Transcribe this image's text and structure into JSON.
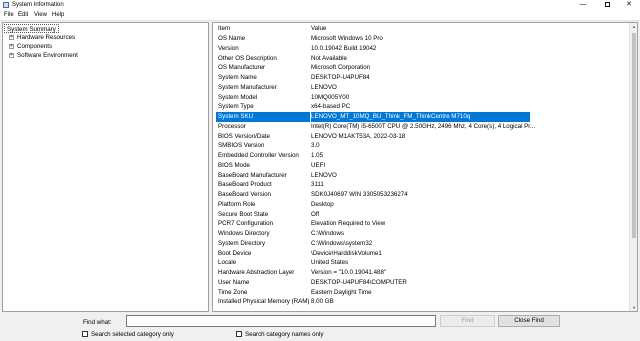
{
  "window": {
    "title": "System Information",
    "minimize_glyph": "—",
    "close_glyph": "✕"
  },
  "menu": [
    "File",
    "Edit",
    "View",
    "Help"
  ],
  "tree": {
    "root": "System Summary",
    "children": [
      "Hardware Resources",
      "Components",
      "Software Environment"
    ],
    "expander_glyph": "+"
  },
  "details": {
    "headers": {
      "item": "Item",
      "value": "Value"
    },
    "selected_index": 8,
    "rows": [
      {
        "item": "OS Name",
        "value": "Microsoft Windows 10 Pro"
      },
      {
        "item": "Version",
        "value": "10.0.19042 Build 19042"
      },
      {
        "item": "Other OS Description",
        "value": "Not Available"
      },
      {
        "item": "OS Manufacturer",
        "value": "Microsoft Corporation"
      },
      {
        "item": "System Name",
        "value": "DESKTOP-U4PUF84"
      },
      {
        "item": "System Manufacturer",
        "value": "LENOVO"
      },
      {
        "item": "System Model",
        "value": "10MQ005Y00"
      },
      {
        "item": "System Type",
        "value": "x64-based PC"
      },
      {
        "item": "System SKU",
        "value": "LENOVO_MT_10MQ_BU_Think_FM_ThinkCentre M710q"
      },
      {
        "item": "Processor",
        "value": "Intel(R) Core(TM) i5-6500T CPU @ 2.50GHz, 2496 Mhz, 4 Core(s), 4 Logical Pr..."
      },
      {
        "item": "BIOS Version/Date",
        "value": "LENOVO M1AKT53A, 2022-03-18"
      },
      {
        "item": "SMBIOS Version",
        "value": "3.0"
      },
      {
        "item": "Embedded Controller Version",
        "value": "1.05"
      },
      {
        "item": "BIOS Mode",
        "value": "UEFI"
      },
      {
        "item": "BaseBoard Manufacturer",
        "value": "LENOVO"
      },
      {
        "item": "BaseBoard Product",
        "value": "3111"
      },
      {
        "item": "BaseBoard Version",
        "value": "SDK0J40697 WIN 3305053236274"
      },
      {
        "item": "Platform Role",
        "value": "Desktop"
      },
      {
        "item": "Secure Boot State",
        "value": "Off"
      },
      {
        "item": "PCR7 Configuration",
        "value": "Elevation Required to View"
      },
      {
        "item": "Windows Directory",
        "value": "C:\\Windows"
      },
      {
        "item": "System Directory",
        "value": "C:\\Windows\\system32"
      },
      {
        "item": "Boot Device",
        "value": "\\Device\\HarddiskVolume1"
      },
      {
        "item": "Locale",
        "value": "United States"
      },
      {
        "item": "Hardware Abstraction Layer",
        "value": "Version = \"10.0.19041.488\""
      },
      {
        "item": "User Name",
        "value": "DESKTOP-U4PUF84\\COMPUTER"
      },
      {
        "item": "Time Zone",
        "value": "Eastern Daylight Time"
      },
      {
        "item": "Installed Physical Memory (RAM)",
        "value": "8.00 GB"
      }
    ]
  },
  "findbar": {
    "label": "Find what:",
    "input_value": "",
    "find_button": "Find",
    "close_find_button": "Close Find",
    "check_selected_category": "Search selected category only",
    "check_category_names": "Search category names only"
  },
  "colors": {
    "selection": "#0078d7",
    "window_bg": "#f0f0f0"
  }
}
